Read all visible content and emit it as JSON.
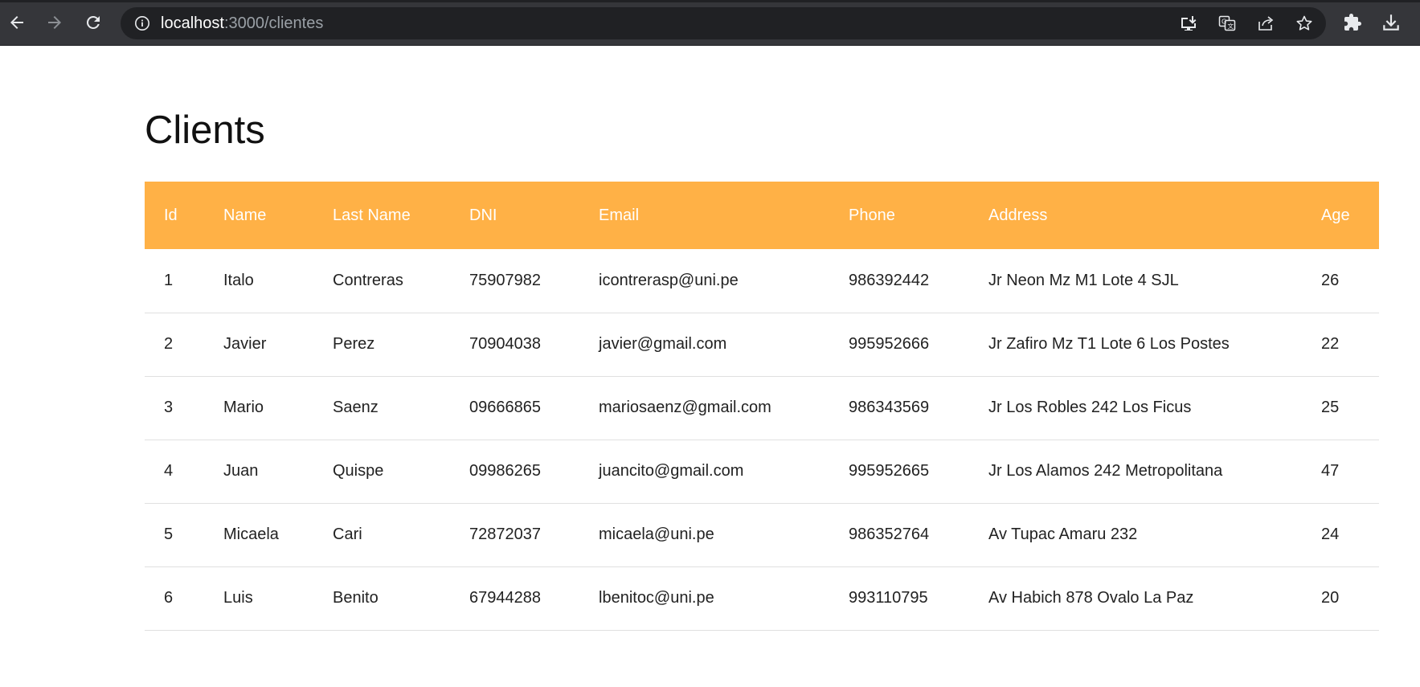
{
  "browser": {
    "url_host": "localhost",
    "url_path": ":3000/clientes"
  },
  "page": {
    "title": "Clients"
  },
  "table": {
    "columns": [
      "Id",
      "Name",
      "Last Name",
      "DNI",
      "Email",
      "Phone",
      "Address",
      "Age"
    ],
    "rows": [
      [
        "1",
        "Italo",
        "Contreras",
        "75907982",
        "icontrerasp@uni.pe",
        "986392442",
        "Jr Neon Mz M1 Lote 4 SJL",
        "26"
      ],
      [
        "2",
        "Javier",
        "Perez",
        "70904038",
        "javier@gmail.com",
        "995952666",
        "Jr Zafiro Mz T1 Lote 6 Los Postes",
        "22"
      ],
      [
        "3",
        "Mario",
        "Saenz",
        "09666865",
        "mariosaenz@gmail.com",
        "986343569",
        "Jr Los Robles 242 Los Ficus",
        "25"
      ],
      [
        "4",
        "Juan",
        "Quispe",
        "09986265",
        "juancito@gmail.com",
        "995952665",
        "Jr Los Alamos 242 Metropolitana",
        "47"
      ],
      [
        "5",
        "Micaela",
        "Cari",
        "72872037",
        "micaela@uni.pe",
        "986352764",
        "Av Tupac Amaru 232",
        "24"
      ],
      [
        "6",
        "Luis",
        "Benito",
        "67944288",
        "lbenitoc@uni.pe",
        "993110795",
        "Av Habich 878 Ovalo La Paz",
        "20"
      ]
    ]
  },
  "colors": {
    "header_bg": "#ffb146",
    "toolbar_bg": "#35363a",
    "omnibox_bg": "#202124"
  },
  "icons": {
    "back": "arrow-left-icon",
    "forward": "arrow-right-icon",
    "reload": "reload-icon",
    "info": "info-icon",
    "install": "install-app-icon",
    "translate": "translate-icon",
    "share": "share-icon",
    "bookmark": "star-icon",
    "extensions": "puzzle-icon",
    "downloads": "download-icon"
  }
}
